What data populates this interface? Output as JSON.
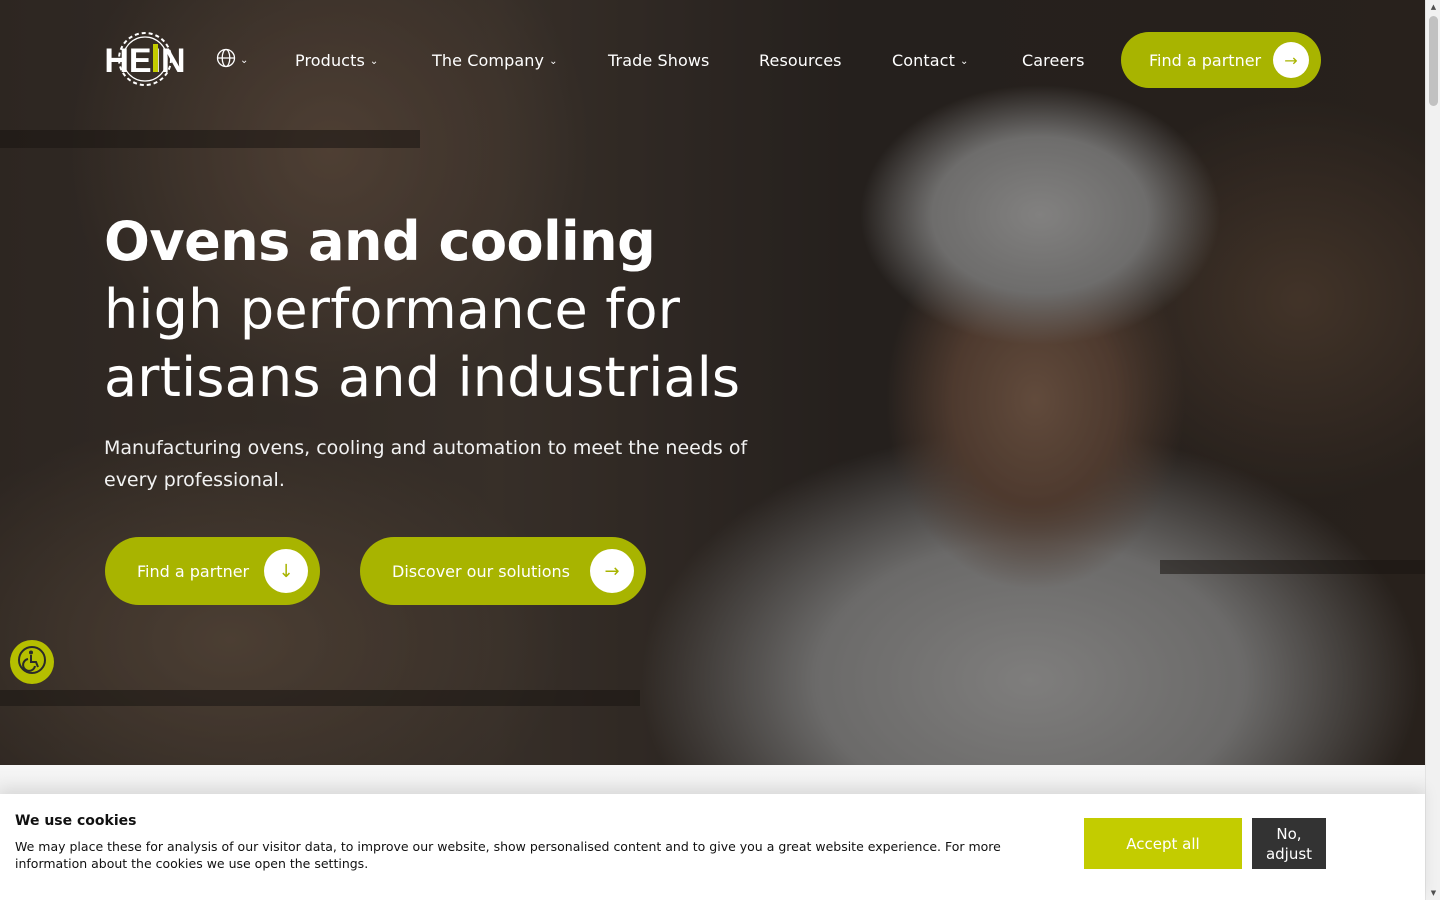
{
  "nav": {
    "logo_text": "HEIN",
    "language_icon": "globe-icon",
    "items": [
      {
        "label": "Products",
        "has_dropdown": true
      },
      {
        "label": "The Company",
        "has_dropdown": true
      },
      {
        "label": "Trade Shows",
        "has_dropdown": false
      },
      {
        "label": "Resources",
        "has_dropdown": false
      },
      {
        "label": "Contact",
        "has_dropdown": true
      },
      {
        "label": "Careers",
        "has_dropdown": false
      }
    ],
    "cta_label": "Find a partner"
  },
  "hero": {
    "title_bold": "Ovens and cooling",
    "title_light": "high performance for artisans and industrials",
    "lead": "Manufacturing ovens, cooling and automation to meet the needs of every professional.",
    "button_partner": "Find a partner",
    "button_solutions": "Discover our solutions"
  },
  "cookie": {
    "title": "We use cookies",
    "text": "We may place these for analysis of our visitor data, to improve our website, show personalised content and to give you a great website experience. For more information about the cookies we use open the settings.",
    "accept_label": "Accept all",
    "adjust_label": "No, adjust"
  },
  "colors": {
    "accent": "#a8b400",
    "accept_button": "#c3cc00",
    "adjust_button": "#333333"
  }
}
